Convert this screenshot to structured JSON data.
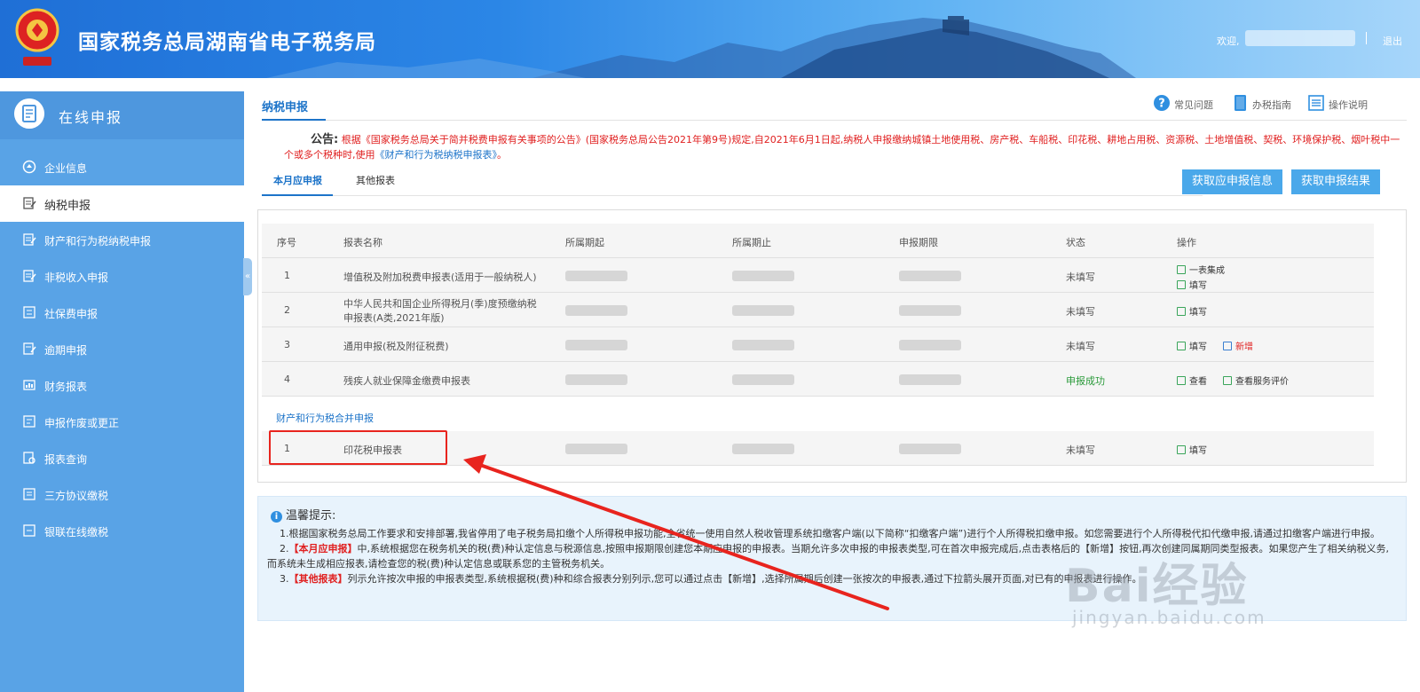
{
  "header": {
    "site_title": "国家税务总局湖南省电子税务局",
    "welcome_label": "欢迎,",
    "logout_label": "退出"
  },
  "sidebar": {
    "title": "在线申报",
    "items": [
      {
        "label": "企业信息",
        "icon": "building-icon"
      },
      {
        "label": "纳税申报",
        "icon": "edit-form-icon",
        "active": true
      },
      {
        "label": "财产和行为税纳税申报",
        "icon": "property-tax-icon"
      },
      {
        "label": "非税收入申报",
        "icon": "non-tax-icon"
      },
      {
        "label": "社保费申报",
        "icon": "social-security-icon"
      },
      {
        "label": "逾期申报",
        "icon": "overdue-icon"
      },
      {
        "label": "财务报表",
        "icon": "finance-report-icon"
      },
      {
        "label": "申报作废或更正",
        "icon": "void-correct-icon"
      },
      {
        "label": "报表查询",
        "icon": "report-query-icon"
      },
      {
        "label": "三方协议缴税",
        "icon": "agreement-icon"
      },
      {
        "label": "银联在线缴税",
        "icon": "unionpay-icon"
      }
    ]
  },
  "main": {
    "tab_title": "纳税申报",
    "tools": [
      {
        "label": "常见问题",
        "icon": "question-icon"
      },
      {
        "label": "办税指南",
        "icon": "guide-book-icon"
      },
      {
        "label": "操作说明",
        "icon": "manual-icon"
      }
    ],
    "notice": {
      "label": "公告:",
      "text": "根据《国家税务总局关于简并税费申报有关事项的公告》(国家税务总局公告2021年第9号)规定,自2021年6月1日起,纳税人申报缴纳城镇土地使用税、房产税、车船税、印花税、耕地占用税、资源税、土地增值税、契税、环境保护税、烟叶税中一个或多个税种时,使用",
      "link": "《财产和行为税纳税申报表》",
      "end": "。"
    },
    "sub_tabs": [
      "本月应申报",
      "其他报表"
    ],
    "buttons": [
      "获取应申报信息",
      "获取申报结果"
    ],
    "table": {
      "columns": [
        "序号",
        "报表名称",
        "所属期起",
        "所属期止",
        "申报期限",
        "状态",
        "操作"
      ],
      "rows": [
        {
          "no": "1",
          "name": "增值税及附加税费申报表(适用于一般纳税人)",
          "status": "未填写",
          "ops": [
            "一表集成",
            "填写"
          ]
        },
        {
          "no": "2",
          "name_line1": "中华人民共和国企业所得税月(季)度预缴纳税",
          "name_line2": "申报表(A类,2021年版)",
          "status": "未填写",
          "ops": [
            "填写"
          ]
        },
        {
          "no": "3",
          "name": "通用申报(税及附征税费)",
          "status": "未填写",
          "ops": [
            "填写",
            "新增"
          ]
        },
        {
          "no": "4",
          "name": "残疾人就业保障金缴费申报表",
          "status": "申报成功",
          "ops": [
            "查看",
            "查看服务评价"
          ]
        }
      ],
      "group_label": "财产和行为税合并申报",
      "group_rows": [
        {
          "no": "1",
          "name": "印花税申报表",
          "status": "未填写",
          "ops": [
            "填写"
          ]
        }
      ]
    },
    "tips": {
      "title": "温馨提示:",
      "p1": "1.根据国家税务总局工作要求和安排部署,我省停用了电子税务局扣缴个人所得税申报功能,全省统一使用自然人税收管理系统扣缴客户端(以下简称“扣缴客户端”)进行个人所得税扣缴申报。如您需要进行个人所得税代扣代缴申报,请通过扣缴客户端进行申报。",
      "p2_pre": "2.",
      "p2_hl": "【本月应申报】",
      "p2": "中,系统根据您在税务机关的税(费)种认定信息与税源信息,按照申报期限创建您本期应申报的申报表。当期允许多次申报的申报表类型,可在首次申报完成后,点击表格后的【新增】按钮,再次创建同属期同类型报表。如果您产生了相关纳税义务,而系统未生成相应报表,请检查您的税(费)种认定信息或联系您的主管税务机关。",
      "p3_pre": "3.",
      "p3_hl": "【其他报表】",
      "p3": "列示允许按次申报的申报表类型,系统根据税(费)种和综合报表分别列示,您可以通过点击【新增】,选择所属期后创建一张按次的申报表,通过下拉箭头展开页面,对已有的申报表进行操作。"
    }
  },
  "watermark": {
    "main": "Bai经验",
    "sub": "jingyan.baidu.com"
  },
  "colors": {
    "primary_blue": "#1d74c9",
    "sidebar_blue": "#59a3e6",
    "button_blue": "#4aa8ea",
    "alert_red": "#e02020",
    "success_green": "#2a9a3a"
  }
}
